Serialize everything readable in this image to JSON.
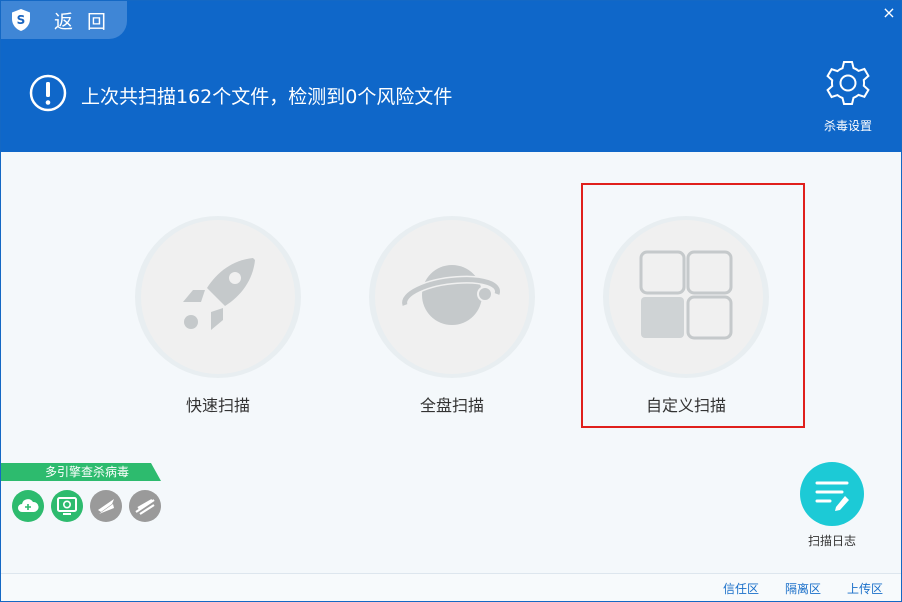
{
  "header": {
    "back_label": "返 回",
    "close_glyph": "×",
    "status_text": "上次共扫描162个文件，检测到0个风险文件",
    "settings_label": "杀毒设置",
    "colors": {
      "header_bg": "#0f67c9",
      "tab_bg": "#3f86d6"
    }
  },
  "scan_options": [
    {
      "label": "快速扫描",
      "icon": "rocket-icon"
    },
    {
      "label": "全盘扫描",
      "icon": "planet-icon"
    },
    {
      "label": "自定义扫描",
      "icon": "grid-icon",
      "highlighted": true
    }
  ],
  "engines": {
    "banner_label": "多引擎查杀病毒",
    "items": [
      {
        "icon": "cloud-engine-icon",
        "status": "active",
        "color": "#2dbb6e"
      },
      {
        "icon": "local-engine-icon",
        "status": "active",
        "color": "#2dbb6e"
      },
      {
        "icon": "engine-3-icon",
        "status": "inactive",
        "color": "#9a9a9a"
      },
      {
        "icon": "engine-4-icon",
        "status": "inactive",
        "color": "#9a9a9a"
      }
    ]
  },
  "scan_log": {
    "label": "扫描日志",
    "icon": "log-icon",
    "color": "#1ccad6"
  },
  "footer": {
    "links": [
      "信任区",
      "隔离区",
      "上传区"
    ]
  }
}
